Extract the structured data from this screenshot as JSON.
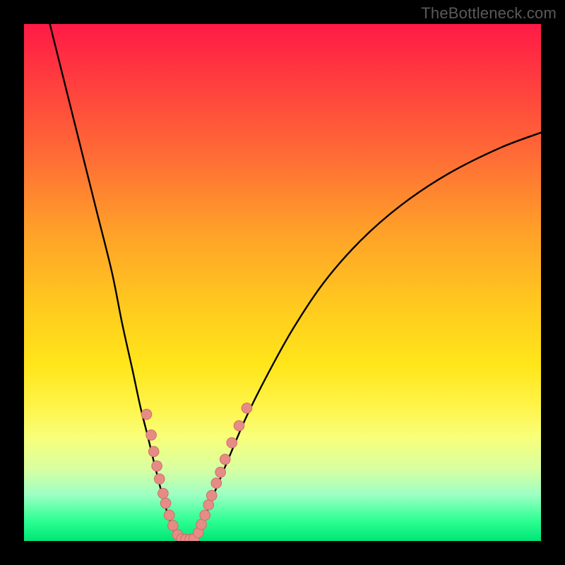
{
  "attribution": "TheBottleneck.com",
  "colors": {
    "frame": "#000000",
    "gradient_top": "#ff1a46",
    "gradient_mid": "#ffe61a",
    "gradient_bottom": "#00e676",
    "curve": "#000000",
    "dot_fill": "#e58c86",
    "dot_stroke": "#cf6d65"
  },
  "chart_data": {
    "type": "line",
    "title": "",
    "xlabel": "",
    "ylabel": "",
    "xlim": [
      0,
      100
    ],
    "ylim": [
      0,
      100
    ],
    "series": [
      {
        "name": "left-branch",
        "x": [
          5,
          8,
          11,
          14,
          17,
          19,
          21,
          22.5,
          24,
          25.2,
          26.2,
          27,
          27.7,
          28.3,
          28.8,
          29.4,
          30
        ],
        "y": [
          100,
          88,
          76,
          64,
          52,
          42,
          33,
          26,
          20,
          15,
          11,
          8,
          5.5,
          3.8,
          2.5,
          1.3,
          0.5
        ]
      },
      {
        "name": "valley-floor",
        "x": [
          30,
          30.7,
          31.5,
          32.3,
          33
        ],
        "y": [
          0.5,
          0.2,
          0.15,
          0.2,
          0.5
        ]
      },
      {
        "name": "right-branch",
        "x": [
          33,
          34,
          35.5,
          37.5,
          40,
          43,
          47,
          52,
          58,
          65,
          73,
          82,
          92,
          100
        ],
        "y": [
          0.5,
          2.5,
          6,
          11,
          17,
          24,
          32,
          41,
          50,
          58,
          65,
          71,
          76,
          79
        ]
      }
    ],
    "dots_left": [
      {
        "x": 23.7,
        "y": 24.5
      },
      {
        "x": 24.6,
        "y": 20.5
      },
      {
        "x": 25.1,
        "y": 17.3
      },
      {
        "x": 25.7,
        "y": 14.5
      },
      {
        "x": 26.2,
        "y": 12.0
      },
      {
        "x": 26.9,
        "y": 9.2
      },
      {
        "x": 27.4,
        "y": 7.3
      },
      {
        "x": 28.1,
        "y": 5.0
      },
      {
        "x": 28.8,
        "y": 3.0
      },
      {
        "x": 29.7,
        "y": 1.2
      }
    ],
    "dots_bottom": [
      {
        "x": 30.5,
        "y": 0.4
      },
      {
        "x": 31.3,
        "y": 0.3
      },
      {
        "x": 32.1,
        "y": 0.3
      },
      {
        "x": 32.9,
        "y": 0.5
      }
    ],
    "dots_right": [
      {
        "x": 33.7,
        "y": 1.6
      },
      {
        "x": 34.3,
        "y": 3.2
      },
      {
        "x": 35.0,
        "y": 5.0
      },
      {
        "x": 35.7,
        "y": 7.0
      },
      {
        "x": 36.3,
        "y": 8.8
      },
      {
        "x": 37.2,
        "y": 11.2
      },
      {
        "x": 38.0,
        "y": 13.3
      },
      {
        "x": 38.9,
        "y": 15.8
      },
      {
        "x": 40.2,
        "y": 19.0
      },
      {
        "x": 41.6,
        "y": 22.3
      },
      {
        "x": 43.1,
        "y": 25.7
      }
    ]
  }
}
